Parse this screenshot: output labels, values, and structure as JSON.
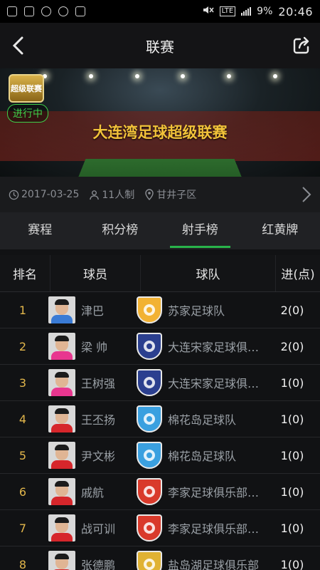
{
  "status_bar": {
    "network": "LTE",
    "battery": "9%",
    "time": "20:46"
  },
  "header": {
    "title": "联赛"
  },
  "banner": {
    "logo_text": "超级联赛",
    "status": "进行中",
    "league_name": "大连湾足球超级联赛"
  },
  "info": {
    "date": "2017-03-25",
    "format": "11人制",
    "location": "甘井子区"
  },
  "tabs": [
    {
      "label": "赛程",
      "active": false
    },
    {
      "label": "积分榜",
      "active": false
    },
    {
      "label": "射手榜",
      "active": true
    },
    {
      "label": "红黄牌",
      "active": false
    }
  ],
  "table": {
    "headers": {
      "rank": "排名",
      "player": "球员",
      "team": "球队",
      "goals": "进(点)"
    },
    "rows": [
      {
        "rank": "1",
        "player": "津巴",
        "team": "苏家足球队",
        "goals": "2(0)",
        "shirt": "#3a7bd5",
        "badge": "#f2b233",
        "badge_icon": "shield-orange-icon"
      },
      {
        "rank": "2",
        "player": "梁 帅",
        "team": "大连宋家足球俱…",
        "goals": "2(0)",
        "shirt": "#e8368f",
        "badge": "#2b3f8f",
        "badge_icon": "shield-navy-icon"
      },
      {
        "rank": "3",
        "player": "王树强",
        "team": "大连宋家足球俱…",
        "goals": "1(0)",
        "shirt": "#e8368f",
        "badge": "#2b3f8f",
        "badge_icon": "shield-navy-icon"
      },
      {
        "rank": "4",
        "player": "王丕扬",
        "team": "棉花岛足球队",
        "goals": "1(0)",
        "shirt": "#d6262b",
        "badge": "#3aa0e0",
        "badge_icon": "shield-blue-icon"
      },
      {
        "rank": "5",
        "player": "尹文彬",
        "team": "棉花岛足球队",
        "goals": "1(0)",
        "shirt": "#d6262b",
        "badge": "#3aa0e0",
        "badge_icon": "shield-blue-icon"
      },
      {
        "rank": "6",
        "player": "戚航",
        "team": "李家足球俱乐部…",
        "goals": "1(0)",
        "shirt": "#d6262b",
        "badge": "#d93a2b",
        "badge_icon": "shield-red-gold-icon"
      },
      {
        "rank": "7",
        "player": "战可训",
        "team": "李家足球俱乐部…",
        "goals": "1(0)",
        "shirt": "#d6262b",
        "badge": "#d93a2b",
        "badge_icon": "shield-red-gold-icon"
      },
      {
        "rank": "8",
        "player": "张德鹏",
        "team": "盐岛湖足球俱乐部",
        "goals": "1(0)",
        "shirt": "#d6262b",
        "badge": "#e0b233",
        "badge_icon": "shield-gold-icon"
      }
    ]
  }
}
